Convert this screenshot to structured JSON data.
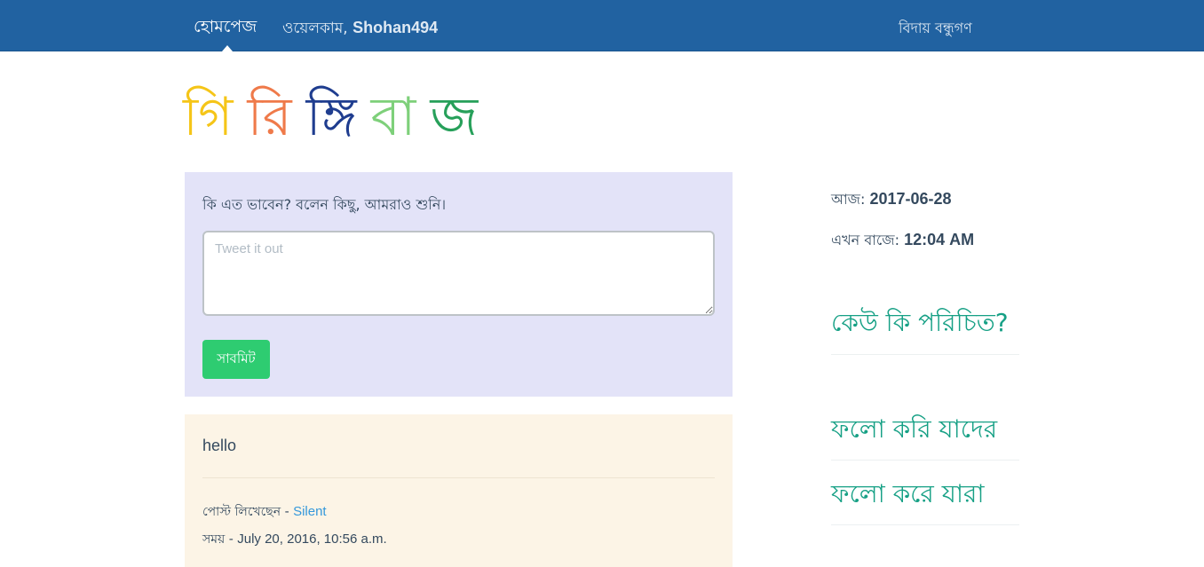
{
  "nav": {
    "home": "হোমপেজ",
    "welcome_prefix": "ওয়েলকাম, ",
    "username": "Shohan494",
    "logout": "বিদায় বন্ধুগণ"
  },
  "logo": {
    "letters": [
      {
        "char": "গি",
        "color": "#f5c518"
      },
      {
        "char": "রি",
        "color": "#ef7a4a"
      },
      {
        "char": "ঙ্গি",
        "color": "#1f3d8f"
      },
      {
        "char": "বা",
        "color": "#7ed07a"
      },
      {
        "char": "জ",
        "color": "#27a05a"
      }
    ]
  },
  "compose": {
    "prompt": "কি এত ভাবেন? বলেন কিছু, আমরাও শুনি।",
    "placeholder": "Tweet it out",
    "value": "",
    "submit": "সাবমিট"
  },
  "post": {
    "text": "hello",
    "author_label": "পোস্ট লিখেছেন - ",
    "author": "Silent",
    "time_label": "সময় - ",
    "time": "July 20, 2016, 10:56 a.m."
  },
  "sidebar": {
    "date_label": "আজ: ",
    "date": "2017-06-28",
    "time_label": "এখন বাজে: ",
    "time": "12:04 AM",
    "who_to_follow": "কেউ কি পরিচিত?",
    "following": "ফলো করি যাদের",
    "followers": "ফলো করে যারা"
  },
  "colors": {
    "navbar": "#2162a1",
    "compose_bg": "#e3e3f8",
    "post_bg": "#fcf4e6",
    "submit": "#2ecc71",
    "heading": "#16a085",
    "link": "#3498db"
  }
}
